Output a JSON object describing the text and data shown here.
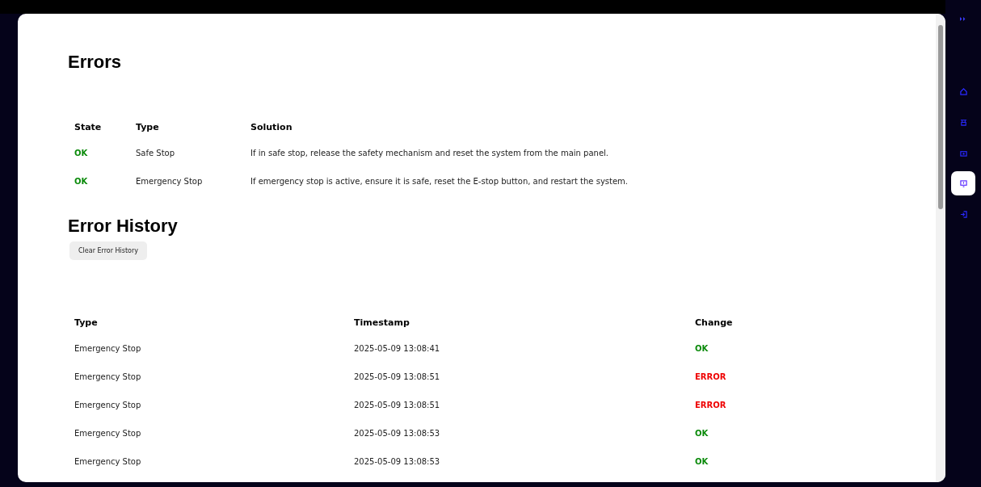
{
  "errors": {
    "title": "Errors",
    "columns": [
      "State",
      "Type",
      "Solution"
    ],
    "rows": [
      {
        "state": "OK",
        "color": "#0a8a0a",
        "type": "Safe Stop",
        "solution": "If in safe stop, release the safety mechanism and reset the system from the main panel."
      },
      {
        "state": "OK",
        "color": "#0a8a0a",
        "type": "Emergency Stop",
        "solution": "If emergency stop is active, ensure it is safe, reset the E-stop button, and restart the system."
      }
    ]
  },
  "history": {
    "title": "Error History",
    "clear_button": "Clear Error History",
    "columns": [
      "Type",
      "Timestamp",
      "Change"
    ],
    "rows": [
      {
        "type": "Emergency Stop",
        "timestamp": "2025-05-09 13:08:41",
        "change": "OK",
        "color": "#0a8a0a"
      },
      {
        "type": "Emergency Stop",
        "timestamp": "2025-05-09 13:08:51",
        "change": "ERROR",
        "color": "#ee0000"
      },
      {
        "type": "Emergency Stop",
        "timestamp": "2025-05-09 13:08:51",
        "change": "ERROR",
        "color": "#ee0000"
      },
      {
        "type": "Emergency Stop",
        "timestamp": "2025-05-09 13:08:53",
        "change": "OK",
        "color": "#0a8a0a"
      },
      {
        "type": "Emergency Stop",
        "timestamp": "2025-05-09 13:08:53",
        "change": "OK",
        "color": "#0a8a0a"
      }
    ]
  },
  "sidebar": {
    "items": [
      {
        "selected": false
      },
      {
        "selected": false
      },
      {
        "selected": false
      },
      {
        "selected": true
      },
      {
        "selected": false
      }
    ]
  }
}
